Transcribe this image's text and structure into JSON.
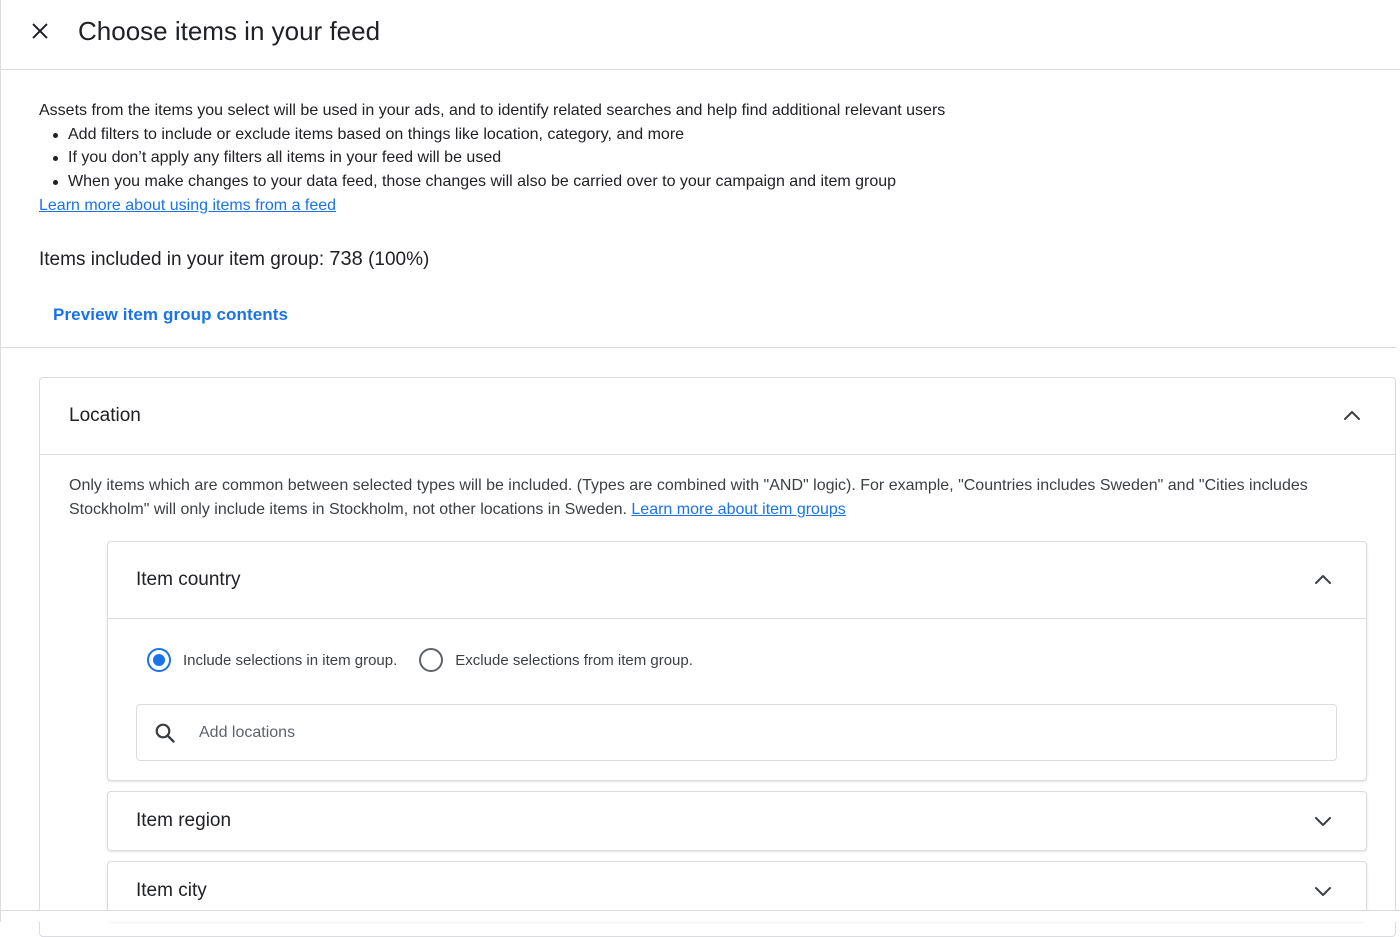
{
  "header": {
    "title": "Choose items in your feed",
    "close_icon": "close-icon"
  },
  "intro": {
    "lead": "Assets from the items you select will be used in your ads, and to identify related searches and help find additional relevant users",
    "bullets": [
      "Add filters to include or exclude items based on things like location, category, and more",
      "If you don’t apply any filters all items in your feed will be used",
      "When you make changes to your data feed, those changes will also be carried over to your campaign and item group"
    ],
    "learn_link": "Learn more about using items from a feed"
  },
  "summary": {
    "label": "Items included in your item group:",
    "count": "738",
    "percent": "(100%)"
  },
  "preview_button": "Preview item group contents",
  "location": {
    "title": "Location",
    "expanded": true,
    "description": "Only items which are common between selected types will be included. (Types are combined with \"AND\" logic). For example, \"Countries includes Sweden\" and \"Cities includes Stockholm\" will only include items in Stockholm, not other locations in Sweden.",
    "learn_link": "Learn more about item groups",
    "sections": {
      "country": {
        "title": "Item country",
        "expanded": true,
        "include_label": "Include selections in item group.",
        "exclude_label": "Exclude selections from item group.",
        "selected": "include",
        "search_placeholder": "Add locations",
        "search_value": ""
      },
      "region": {
        "title": "Item region",
        "expanded": false
      },
      "city": {
        "title": "Item city",
        "expanded": false
      }
    }
  },
  "colors": {
    "accent": "#1a73e8",
    "text": "#202124",
    "border": "#dadce0"
  }
}
